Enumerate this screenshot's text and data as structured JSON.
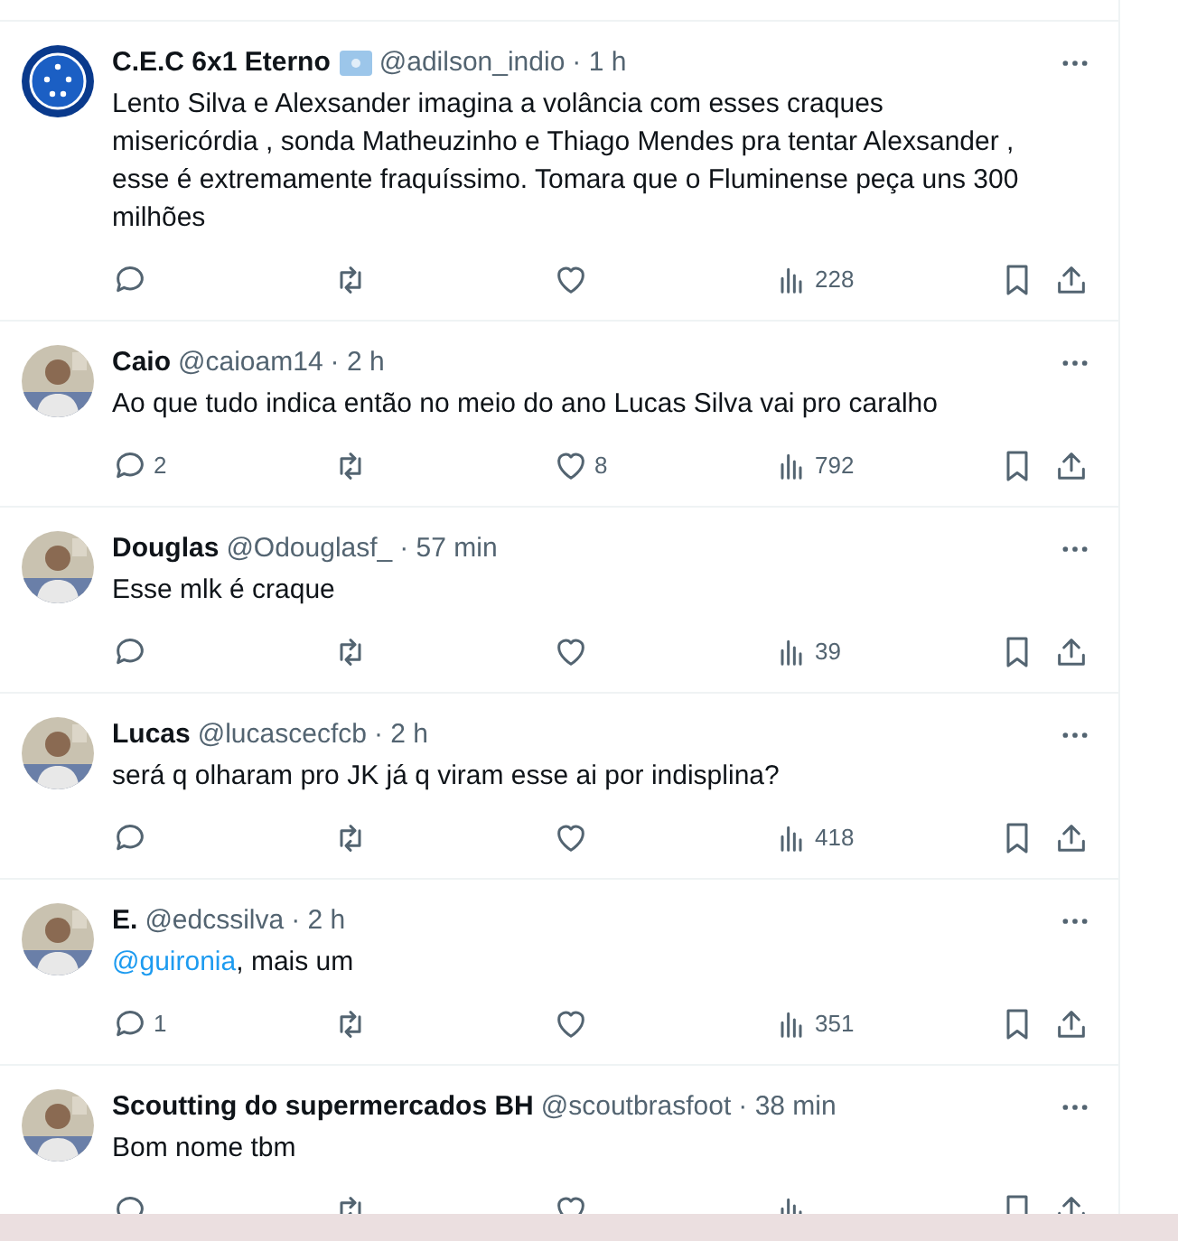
{
  "tweets": [
    {
      "name": "C.E.C 6x1 Eterno",
      "badge": true,
      "handle": "@adilson_indio",
      "time": "· 1 h",
      "avatar": {
        "kind": "logo"
      },
      "body": [
        {
          "kind": "plain",
          "text": "Lento Silva e Alexsander imagina a volância com esses craques misericórdia , sonda Matheuzinho e Thiago Mendes pra tentar Alexsander , esse é extremamente fraquíssimo. Tomara que o Fluminense peça uns 300 milhões"
        }
      ],
      "views": "228"
    },
    {
      "name": "Caio",
      "badge": false,
      "handle": "@caioam14",
      "time": "· 2 h",
      "avatar": {
        "kind": "picture"
      },
      "body": [
        {
          "kind": "plain",
          "text": "Ao que tudo indica então no meio do ano Lucas Silva vai pro caralho"
        }
      ],
      "replies": "2",
      "likes": "8",
      "views": "792"
    },
    {
      "name": "Douglas",
      "badge": false,
      "handle": "@Odouglasf_",
      "time": "· 57 min",
      "avatar": {
        "kind": "picture"
      },
      "body": [
        {
          "kind": "plain",
          "text": "Esse mlk é craque"
        }
      ],
      "views": "39"
    },
    {
      "name": "Lucas",
      "badge": false,
      "handle": "@lucascecfcb",
      "time": "· 2 h",
      "avatar": {
        "kind": "picture"
      },
      "body": [
        {
          "kind": "plain",
          "text": "será q olharam pro JK já q viram esse ai por indisplina?"
        }
      ],
      "views": "418"
    },
    {
      "name": "E.",
      "badge": false,
      "handle": "@edcssilva",
      "time": "· 2 h",
      "avatar": {
        "kind": "picture"
      },
      "body": [
        {
          "kind": "mention",
          "text": "@guironia"
        },
        {
          "kind": "plain",
          "text": ", mais um"
        }
      ],
      "replies": "1",
      "views": "351"
    },
    {
      "name": "Scoutting do supermercados BH",
      "badge": false,
      "handle": "@scoutbrasfoot",
      "time": "· 38 min",
      "avatar": {
        "kind": "picture"
      },
      "body": [
        {
          "kind": "plain",
          "text": "Bom nome tbm"
        }
      ]
    }
  ]
}
